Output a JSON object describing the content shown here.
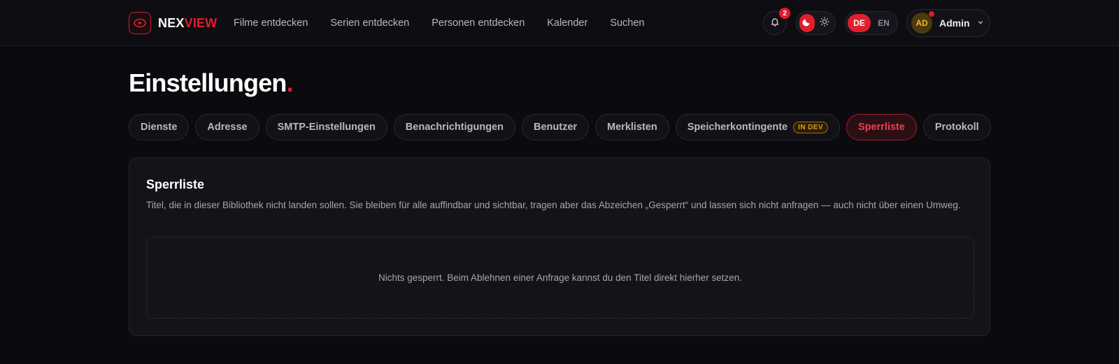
{
  "brand": {
    "name_part1": "NEX",
    "name_part2": "VIEW"
  },
  "nav": [
    {
      "label": "Filme entdecken"
    },
    {
      "label": "Serien entdecken"
    },
    {
      "label": "Personen entdecken"
    },
    {
      "label": "Kalender"
    },
    {
      "label": "Suchen"
    }
  ],
  "notifications": {
    "count": "2"
  },
  "theme": {
    "active": "dark"
  },
  "language": {
    "options": [
      "DE",
      "EN"
    ],
    "active": "DE"
  },
  "user": {
    "initials": "AD",
    "name": "Admin"
  },
  "page": {
    "title": "Einstellungen",
    "title_dot": "."
  },
  "tabs": [
    {
      "label": "Dienste"
    },
    {
      "label": "Adresse"
    },
    {
      "label": "SMTP-Einstellungen"
    },
    {
      "label": "Benachrichtigungen"
    },
    {
      "label": "Benutzer"
    },
    {
      "label": "Merklisten"
    },
    {
      "label": "Speicherkontingente",
      "badge": "IN DEV"
    },
    {
      "label": "Sperrliste",
      "active": true
    },
    {
      "label": "Protokoll"
    }
  ],
  "blocklist": {
    "title": "Sperrliste",
    "description": "Titel, die in dieser Bibliothek nicht landen sollen. Sie bleiben für alle auffindbar und sichtbar, tragen aber das Abzeichen „Gesperrt“ und lassen sich nicht anfragen — auch nicht über einen Umweg.",
    "empty_text": "Nichts gesperrt. Beim Ablehnen einer Anfrage kannst du den Titel direkt hierher setzen."
  },
  "colors": {
    "accent": "#e11d2e",
    "background": "#0b0a0e",
    "badge_dev": "#d99b1e"
  },
  "icons": [
    "play-logo-icon",
    "bell-icon",
    "moon-icon",
    "sun-icon",
    "chevron-down-icon"
  ]
}
